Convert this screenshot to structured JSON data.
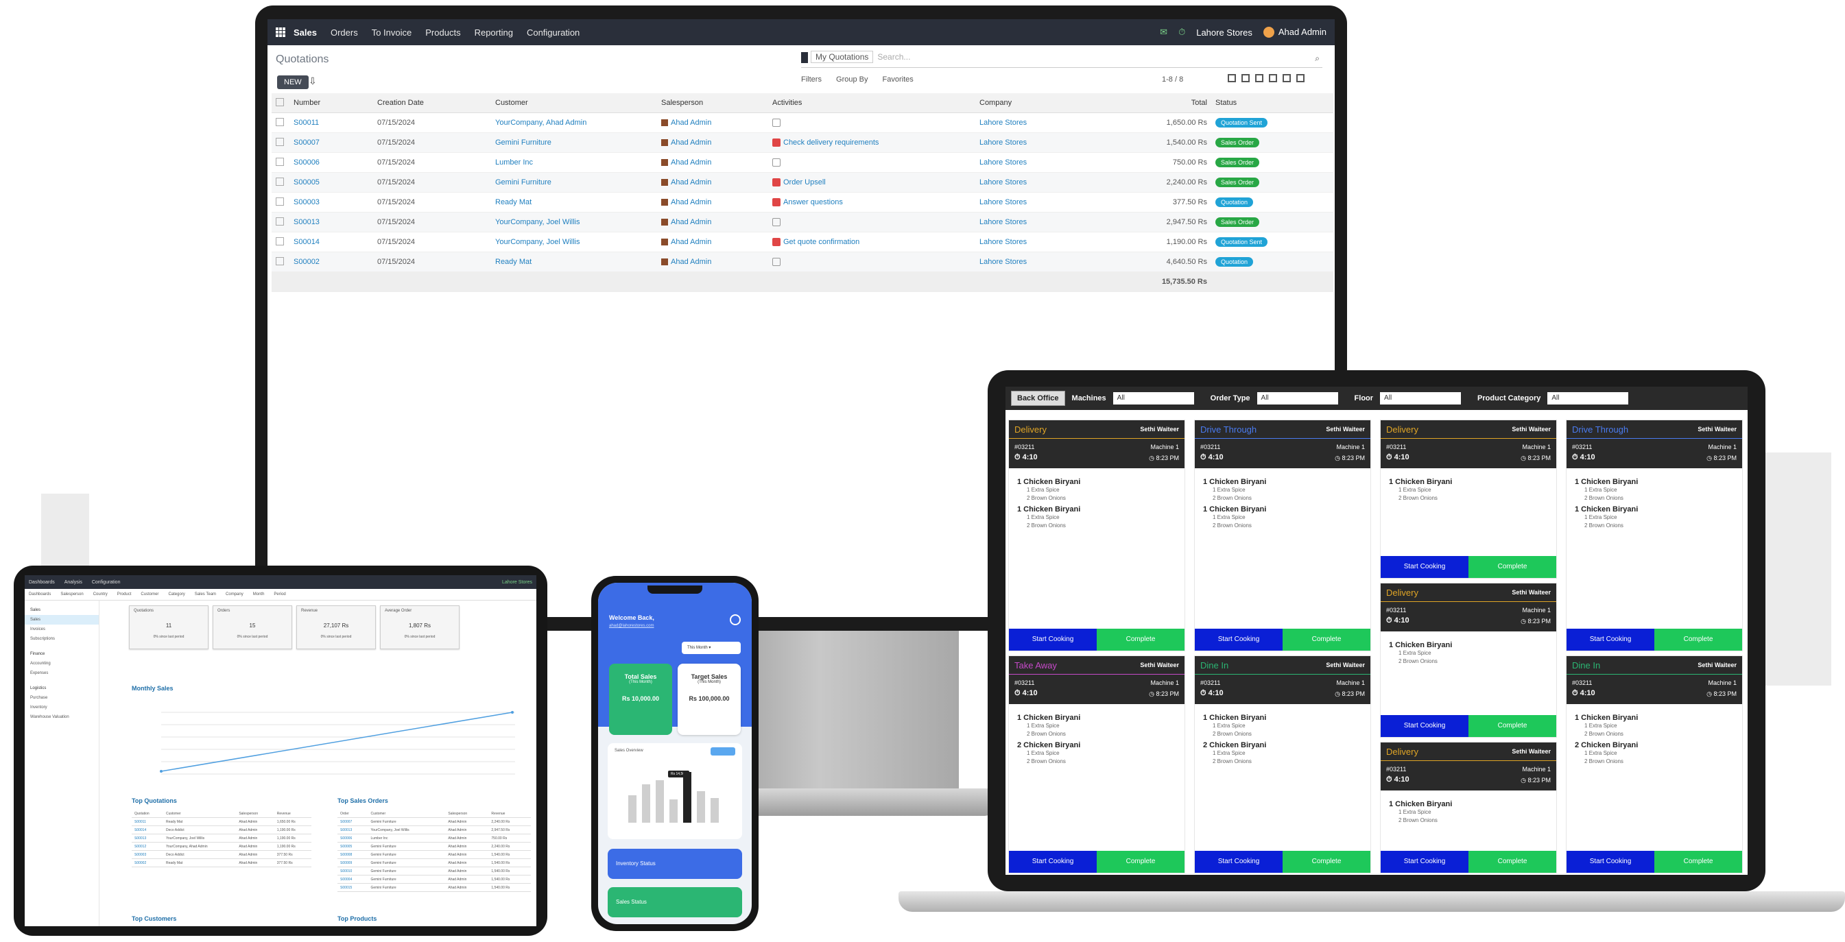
{
  "monitor": {
    "nav": {
      "brand": "Sales",
      "items": [
        "Orders",
        "To Invoice",
        "Products",
        "Reporting",
        "Configuration"
      ],
      "company": "Lahore Stores",
      "user": "Ahad Admin"
    },
    "page_title": "Quotations",
    "new_label": "NEW",
    "search": {
      "facet": "My Quotations",
      "placeholder": "Search..."
    },
    "filters": [
      "Filters",
      "Group By",
      "Favorites"
    ],
    "pager": "1-8 / 8",
    "columns": [
      "Number",
      "Creation Date",
      "Customer",
      "Salesperson",
      "Activities",
      "Company",
      "Total",
      "Status"
    ],
    "rows": [
      {
        "num": "S00011",
        "date": "07/15/2024",
        "cust": "YourCompany, Ahad Admin",
        "sp": "Ahad Admin",
        "act": "",
        "act_red": false,
        "comp": "Lahore Stores",
        "total": "1,650.00 Rs",
        "status": "Quotation Sent",
        "status_color": "blue"
      },
      {
        "num": "S00007",
        "date": "07/15/2024",
        "cust": "Gemini Furniture",
        "sp": "Ahad Admin",
        "act": "Check delivery requirements",
        "act_red": true,
        "comp": "Lahore Stores",
        "total": "1,540.00 Rs",
        "status": "Sales Order",
        "status_color": "green"
      },
      {
        "num": "S00006",
        "date": "07/15/2024",
        "cust": "Lumber Inc",
        "sp": "Ahad Admin",
        "act": "",
        "act_red": false,
        "comp": "Lahore Stores",
        "total": "750.00 Rs",
        "status": "Sales Order",
        "status_color": "green"
      },
      {
        "num": "S00005",
        "date": "07/15/2024",
        "cust": "Gemini Furniture",
        "sp": "Ahad Admin",
        "act": "Order Upsell",
        "act_red": true,
        "comp": "Lahore Stores",
        "total": "2,240.00 Rs",
        "status": "Sales Order",
        "status_color": "green"
      },
      {
        "num": "S00003",
        "date": "07/15/2024",
        "cust": "Ready Mat",
        "sp": "Ahad Admin",
        "act": "Answer questions",
        "act_red": true,
        "comp": "Lahore Stores",
        "total": "377.50 Rs",
        "status": "Quotation",
        "status_color": "blue"
      },
      {
        "num": "S00013",
        "date": "07/15/2024",
        "cust": "YourCompany, Joel Willis",
        "sp": "Ahad Admin",
        "act": "",
        "act_red": false,
        "comp": "Lahore Stores",
        "total": "2,947.50 Rs",
        "status": "Sales Order",
        "status_color": "green"
      },
      {
        "num": "S00014",
        "date": "07/15/2024",
        "cust": "YourCompany, Joel Willis",
        "sp": "Ahad Admin",
        "act": "Get quote confirmation",
        "act_red": true,
        "comp": "Lahore Stores",
        "total": "1,190.00 Rs",
        "status": "Quotation Sent",
        "status_color": "blue"
      },
      {
        "num": "S00002",
        "date": "07/15/2024",
        "cust": "Ready Mat",
        "sp": "Ahad Admin",
        "act": "",
        "act_red": false,
        "comp": "Lahore Stores",
        "total": "4,640.50 Rs",
        "status": "Quotation",
        "status_color": "blue"
      }
    ],
    "grand_total": "15,735.50 Rs"
  },
  "tablet": {
    "nav": [
      "Dashboards",
      "Analysis",
      "Configuration"
    ],
    "nav_right": "Lahore Stores",
    "filterbar": [
      "Dashboards",
      "Salesperson",
      "Country",
      "Product",
      "Customer",
      "Category",
      "Sales Team",
      "Company",
      "Month",
      "Period"
    ],
    "sidebar": {
      "sales_header": "Sales",
      "sales": [
        "Sales",
        "Invoices",
        "Subscriptions"
      ],
      "finance_header": "Finance",
      "finance": [
        "Accounting",
        "Expenses"
      ],
      "logistics_header": "Logistics",
      "logistics": [
        "Purchase",
        "Inventory",
        "Warehouse Valuation"
      ]
    },
    "kpis": [
      {
        "label": "Quotations",
        "value": "11",
        "sub": "0% since last period"
      },
      {
        "label": "Orders",
        "value": "15",
        "sub": "0% since last period"
      },
      {
        "label": "Revenue",
        "value": "27,107 Rs",
        "sub": "0% since last period"
      },
      {
        "label": "Average Order",
        "value": "1,807 Rs",
        "sub": "0% since last period"
      }
    ],
    "monthly_title": "Monthly Sales",
    "top_quotations_title": "Top Quotations",
    "top_orders_title": "Top Sales Orders",
    "top_customers_title": "Top Customers",
    "top_products_title": "Top Products",
    "quot_cols": [
      "Quotation",
      "Customer",
      "Salesperson",
      "Revenue"
    ],
    "quot_rows": [
      [
        "S00011",
        "Ready Mat",
        "Ahad Admin",
        "1,650.00 Rs"
      ],
      [
        "S00014",
        "Deco Addict",
        "Ahad Admin",
        "1,190.00 Rs"
      ],
      [
        "S00013",
        "YourCompany, Joel Willis",
        "Ahad Admin",
        "1,190.00 Rs"
      ],
      [
        "S00012",
        "YourCompany, Ahad Admin",
        "Ahad Admin",
        "1,190.00 Rs"
      ],
      [
        "S00003",
        "Deco Addict",
        "Ahad Admin",
        "377.50 Rs"
      ],
      [
        "S00002",
        "Ready Mat",
        "Ahad Admin",
        "377.50 Rs"
      ]
    ],
    "order_cols": [
      "Order",
      "Customer",
      "Salesperson",
      "Revenue"
    ],
    "order_rows": [
      [
        "S00007",
        "Gemini Furniture",
        "Ahad Admin",
        "2,240.00 Rs"
      ],
      [
        "S00013",
        "YourCompany, Joel Willis",
        "Ahad Admin",
        "2,947.50 Rs"
      ],
      [
        "S00006",
        "Lumber Inc",
        "Ahad Admin",
        "750.00 Rs"
      ],
      [
        "S00005",
        "Gemini Furniture",
        "Ahad Admin",
        "2,240.00 Rs"
      ],
      [
        "S00008",
        "Gemini Furniture",
        "Ahad Admin",
        "1,540.00 Rs"
      ],
      [
        "S00009",
        "Gemini Furniture",
        "Ahad Admin",
        "1,540.00 Rs"
      ],
      [
        "S00010",
        "Gemini Furniture",
        "Ahad Admin",
        "1,540.00 Rs"
      ],
      [
        "S00004",
        "Gemini Furniture",
        "Ahad Admin",
        "1,540.00 Rs"
      ],
      [
        "S00015",
        "Gemini Furniture",
        "Ahad Admin",
        "1,540.00 Rs"
      ]
    ]
  },
  "phone": {
    "welcome": "Welcome Back,",
    "email": "ahad@lahorestores.com",
    "period": "This Month",
    "card_total_label": "Total Sales",
    "card_total_sub": "(This Month)",
    "card_total_val": "Rs 10,000.00",
    "card_target_label": "Target Sales",
    "card_target_sub": "(This Month)",
    "card_target_val": "Rs 100,000.00",
    "chart_label": "Sales Overview",
    "tooltip": "Rs 14,500",
    "btn_inventory": "Inventory Status",
    "btn_sales": "Sales Status"
  },
  "kds": {
    "back_office": "Back Office",
    "filters": [
      {
        "label": "Machines",
        "value": "All"
      },
      {
        "label": "Order Type",
        "value": "All"
      },
      {
        "label": "Floor",
        "value": "All"
      },
      {
        "label": "Product Category",
        "value": "All"
      }
    ],
    "start_label": "Start Cooking",
    "complete_label": "Complete",
    "cards": [
      {
        "type": "Delivery",
        "server": "Sethi Waiteer",
        "order": "#03211",
        "machine": "Machine 1",
        "timer": "4:10",
        "clock": "8:23 PM",
        "type_color": "#e0a526",
        "items": [
          {
            "name": "1  Chicken Biryani",
            "mods": [
              "1 Extra Spice",
              "2 Brown Onions"
            ]
          },
          {
            "name": "1  Chicken Biryani",
            "mods": [
              "1 Extra Spice",
              "2 Brown Onions"
            ]
          }
        ]
      },
      {
        "type": "Drive Through",
        "server": "Sethi Waiteer",
        "order": "#03211",
        "machine": "Machine 1",
        "timer": "4:10",
        "clock": "8:23 PM",
        "type_color": "#4a7bf0",
        "items": [
          {
            "name": "1  Chicken Biryani",
            "mods": [
              "1 Extra Spice",
              "2 Brown Onions"
            ]
          },
          {
            "name": "1  Chicken Biryani",
            "mods": [
              "1 Extra Spice",
              "2 Brown Onions"
            ]
          }
        ]
      },
      {
        "type": "Delivery",
        "server": "Sethi Waiteer",
        "order": "#03211",
        "machine": "Machine 1",
        "timer": "4:10",
        "clock": "8:23 PM",
        "type_color": "#e0a526",
        "items": [
          {
            "name": "1  Chicken Biryani",
            "mods": [
              "1 Extra Spice",
              "2 Brown Onions"
            ]
          }
        ]
      },
      {
        "type": "Drive Through",
        "server": "Sethi Waiteer",
        "order": "#03211",
        "machine": "Machine 1",
        "timer": "4:10",
        "clock": "8:23 PM",
        "type_color": "#4a7bf0",
        "items": [
          {
            "name": "1  Chicken Biryani",
            "mods": [
              "1 Extra Spice",
              "2 Brown Onions"
            ]
          },
          {
            "name": "1  Chicken Biryani",
            "mods": [
              "1 Extra Spice",
              "2 Brown Onions"
            ]
          }
        ]
      },
      {
        "type": "Delivery",
        "server": "Sethi Waiteer",
        "order": "#03211",
        "machine": "Machine 1",
        "timer": "4:10",
        "clock": "8:23 PM",
        "type_color": "#e0a526",
        "items": [
          {
            "name": "1  Chicken Biryani",
            "mods": [
              "1 Extra Spice",
              "2 Brown Onions"
            ]
          }
        ]
      },
      {
        "type": "Take Away",
        "server": "Sethi Waiteer",
        "order": "#03211",
        "machine": "Machine 1",
        "timer": "4:10",
        "clock": "8:23 PM",
        "type_color": "#c64ac9",
        "items": [
          {
            "name": "1  Chicken Biryani",
            "mods": [
              "1 Extra Spice",
              "2 Brown Onions"
            ]
          },
          {
            "name": "2  Chicken Biryani",
            "mods": [
              "1 Extra Spice",
              "2 Brown Onions"
            ]
          }
        ]
      },
      {
        "type": "Dine In",
        "server": "Sethi Waiteer",
        "order": "#03211",
        "machine": "Machine 1",
        "timer": "4:10",
        "clock": "8:23 PM",
        "type_color": "#2bb673",
        "items": [
          {
            "name": "1  Chicken Biryani",
            "mods": [
              "1 Extra Spice",
              "2 Brown Onions"
            ]
          },
          {
            "name": "2  Chicken Biryani",
            "mods": [
              "1 Extra Spice",
              "2 Brown Onions"
            ]
          }
        ]
      },
      {
        "type": "Delivery",
        "server": "Sethi Waiteer",
        "order": "#03211",
        "machine": "Machine 1",
        "timer": "4:10",
        "clock": "8:23 PM",
        "type_color": "#e0a526",
        "items": [
          {
            "name": "1  Chicken Biryani",
            "mods": [
              "1 Extra Spice",
              "2 Brown Onions"
            ]
          }
        ]
      },
      {
        "type": "Dine In",
        "server": "Sethi Waiteer",
        "order": "#03211",
        "machine": "Machine 1",
        "timer": "4:10",
        "clock": "8:23 PM",
        "type_color": "#2bb673",
        "items": [
          {
            "name": "1  Chicken Biryani",
            "mods": [
              "1 Extra Spice",
              "2 Brown Onions"
            ]
          },
          {
            "name": "2  Chicken Biryani",
            "mods": [
              "1 Extra Spice",
              "2 Brown Onions"
            ]
          }
        ]
      }
    ]
  }
}
